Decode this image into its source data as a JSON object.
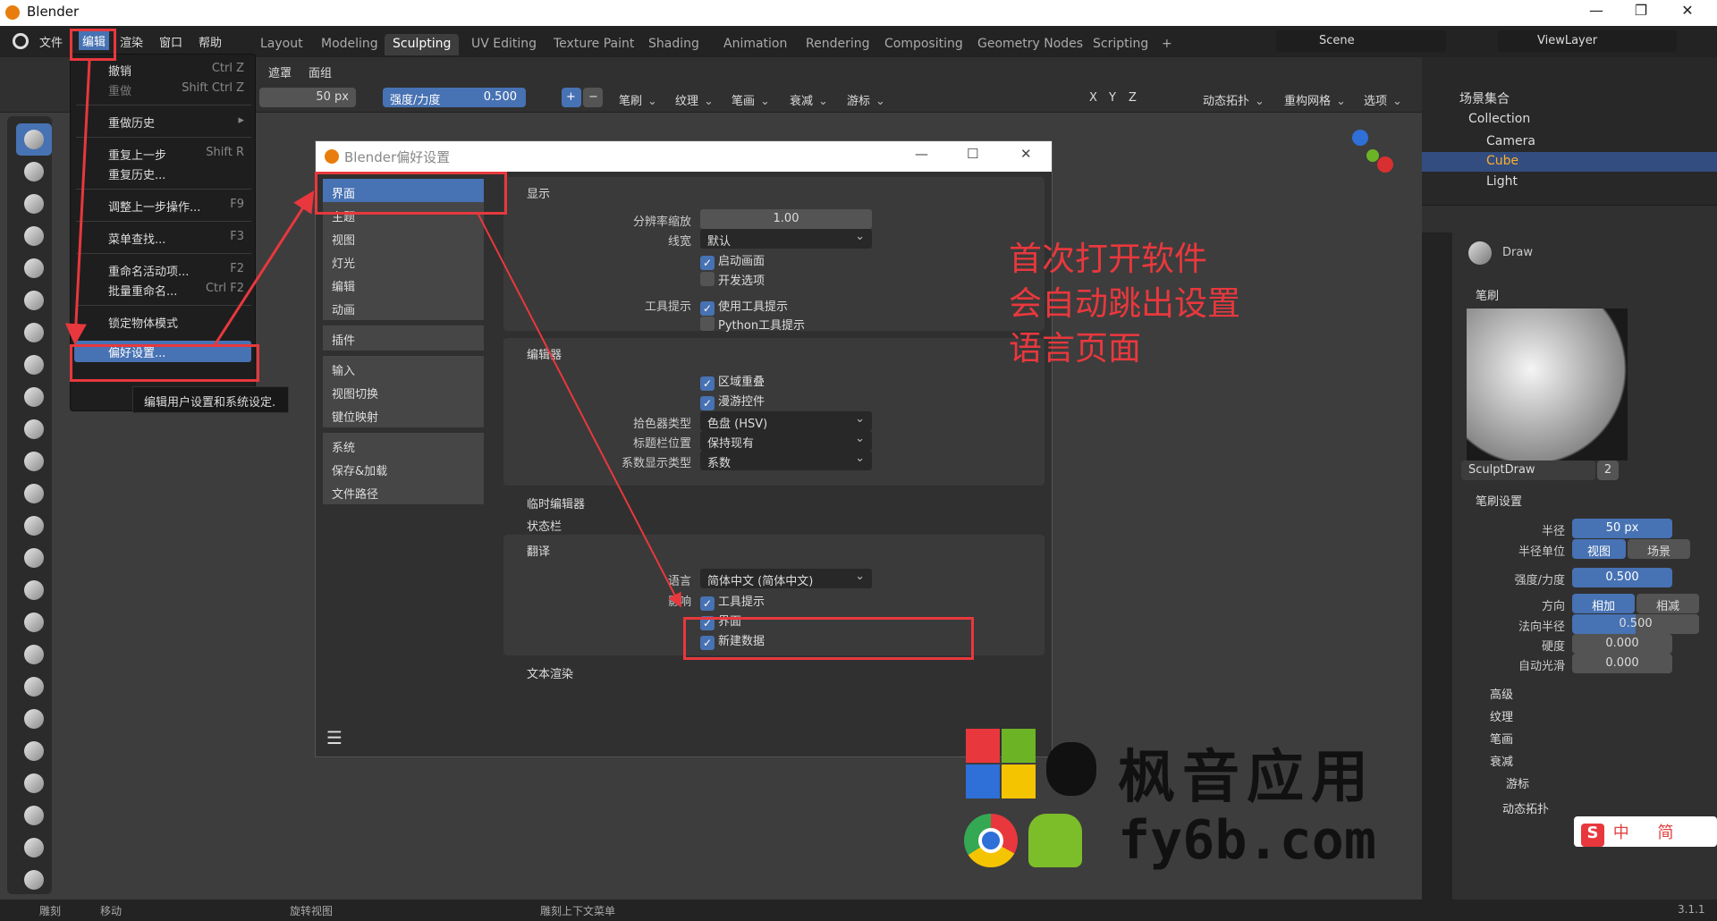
{
  "app": {
    "title": "Blender",
    "version": "3.1.1"
  },
  "colors": {
    "accent": "#4772b3",
    "annotation_red": "#e8383d",
    "blender_orange": "#e87d0d"
  },
  "menubar": [
    "文件",
    "编辑",
    "渲染",
    "窗口",
    "帮助"
  ],
  "workspaces": [
    "Layout",
    "Modeling",
    "Sculpting",
    "UV Editing",
    "Texture Paint",
    "Shading",
    "Animation",
    "Rendering",
    "Compositing",
    "Geometry Nodes",
    "Scripting"
  ],
  "workspace_add": "+",
  "scene": {
    "label": "Scene",
    "view_layer": "ViewLayer"
  },
  "header2": {
    "mask": "遮罩",
    "face_set": "面组"
  },
  "header3": {
    "radius_value": "50 px",
    "strength_label": "强度/力度",
    "strength_value": "0.500",
    "plus": "+",
    "minus": "−",
    "brush": "笔刷",
    "texture": "纹理",
    "stroke": "笔画",
    "falloff": "衰减",
    "cursor": "游标",
    "axis_x": "X",
    "axis_y": "Y",
    "axis_z": "Z",
    "dyntopo": "动态拓扑",
    "remesh": "重构网格",
    "options": "选项"
  },
  "edit_menu": {
    "items": [
      {
        "label": "撤销",
        "shortcut": "Ctrl Z",
        "disabled": false
      },
      {
        "label": "重做",
        "shortcut": "Shift Ctrl Z",
        "disabled": true
      },
      {
        "label": "重做历史",
        "shortcut": "▸",
        "disabled": false
      },
      {
        "label": "重复上一步",
        "shortcut": "Shift R",
        "disabled": false
      },
      {
        "label": "重复历史...",
        "shortcut": "",
        "disabled": false
      },
      {
        "label": "调整上一步操作...",
        "shortcut": "F9",
        "disabled": false
      },
      {
        "label": "菜单查找...",
        "shortcut": "F3",
        "disabled": false
      },
      {
        "label": "重命名活动项...",
        "shortcut": "F2",
        "disabled": false
      },
      {
        "label": "批量重命名...",
        "shortcut": "Ctrl F2",
        "disabled": false
      },
      {
        "label": "锁定物体模式",
        "shortcut": "",
        "disabled": false
      },
      {
        "label": "偏好设置...",
        "shortcut": "",
        "disabled": false
      }
    ],
    "tooltip": "编辑用户设置和系统设定."
  },
  "prefs": {
    "title": "Blender偏好设置",
    "sidebar": [
      "界面",
      "主题",
      "视图",
      "灯光",
      "编辑",
      "动画",
      "插件",
      "输入",
      "视图切换",
      "键位映射",
      "系统",
      "保存&加载",
      "文件路径"
    ],
    "display": {
      "header": "显示",
      "resolution_label": "分辨率缩放",
      "resolution_value": "1.00",
      "linewidth_label": "线宽",
      "linewidth_value": "默认",
      "splash": "启动画面",
      "dev_extras": "开发选项",
      "tooltips_label": "工具提示",
      "use_tooltips": "使用工具提示",
      "python_tooltips": "Python工具提示"
    },
    "editors": {
      "header": "编辑器",
      "region_overlap": "区域重叠",
      "nav_controls": "漫游控件",
      "color_picker_label": "拾色器类型",
      "color_picker_value": "色盘 (HSV)",
      "header_pos_label": "标题栏位置",
      "header_pos_value": "保持现有",
      "factor_label": "系数显示类型",
      "factor_value": "系数",
      "temp_editors": "临时编辑器",
      "status_bar": "状态栏"
    },
    "translation": {
      "header": "翻译",
      "language_label": "语言",
      "language_value": "简体中文 (简体中文)",
      "affect_label": "影响",
      "tooltips": "工具提示",
      "interface": "界面",
      "new_data": "新建数据"
    },
    "text_rendering": "文本渲染",
    "menu_icon": "☰"
  },
  "outliner": {
    "scene_collection": "场景集合",
    "collection": "Collection",
    "items": [
      "Camera",
      "Cube",
      "Light"
    ]
  },
  "properties": {
    "brush_name": "Draw",
    "brush_section": "笔刷",
    "brush_datablock": "SculptDraw",
    "brush_users": "2",
    "settings_section": "笔刷设置",
    "radius_label": "半径",
    "radius_value": "50 px",
    "radius_unit_label": "半径单位",
    "unit_view": "视图",
    "unit_scene": "场景",
    "strength_label": "强度/力度",
    "strength_value": "0.500",
    "direction_label": "方向",
    "dir_add": "相加",
    "dir_sub": "相减",
    "normal_radius_label": "法向半径",
    "normal_radius_value": "0.500",
    "hardness_label": "硬度",
    "hardness_value": "0.000",
    "autosmooth_label": "自动光滑",
    "autosmooth_value": "0.000",
    "subsections": [
      "高级",
      "纹理",
      "笔画",
      "衰减",
      "游标"
    ],
    "dyntopo": "动态拓扑"
  },
  "status": {
    "sculpt": "雕刻",
    "move": "移动",
    "rotate": "旋转视图",
    "context": "雕刻上下文菜单"
  },
  "annotation": {
    "lines": [
      "首次打开软件",
      "会自动跳出设置",
      "语言页面"
    ]
  },
  "watermark": {
    "cn": "枫音应用",
    "url": "fy6b.com"
  },
  "ime": {
    "label": "中",
    "mode": "简"
  }
}
